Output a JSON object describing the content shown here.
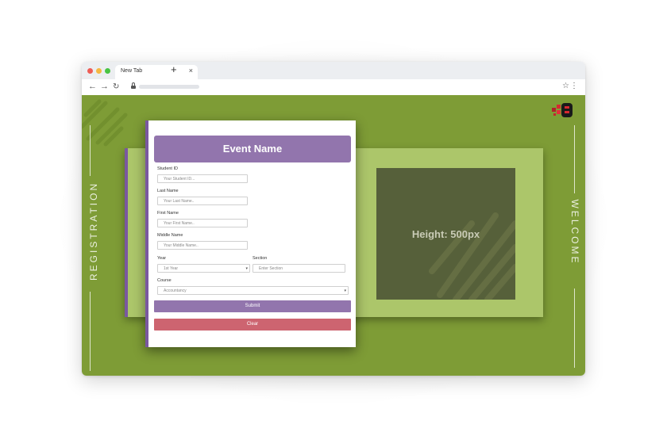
{
  "browser": {
    "tab_title": "New Tab",
    "tab_close": "×",
    "new_tab": "+",
    "nav": {
      "back": "←",
      "forward": "→",
      "reload": "↻"
    },
    "star": "☆",
    "menu": "⋮"
  },
  "page": {
    "side_left": "REGISTRATION",
    "side_right": "WELCOME",
    "panel_text": "Height: 500px",
    "colors": {
      "background": "#7e9c36",
      "card": "#acc66a",
      "panel": "#56603a",
      "accent": "#9275ad",
      "clear": "#cd6470"
    }
  },
  "form": {
    "title": "Event Name",
    "student_id": {
      "label": "Student ID",
      "placeholder": "Your Student ID..."
    },
    "last_name": {
      "label": "Last Name",
      "placeholder": "Your Last Name.."
    },
    "first_name": {
      "label": "First Name",
      "placeholder": "Your First Name.."
    },
    "middle_name": {
      "label": "Middle Name",
      "placeholder": "Your Middle Name.."
    },
    "year": {
      "label": "Year",
      "value": "1st Year"
    },
    "section": {
      "label": "Section",
      "placeholder": "Enter Section"
    },
    "course": {
      "label": "Course",
      "value": "Accountancy"
    },
    "submit": "Submit",
    "clear": "Clear"
  }
}
